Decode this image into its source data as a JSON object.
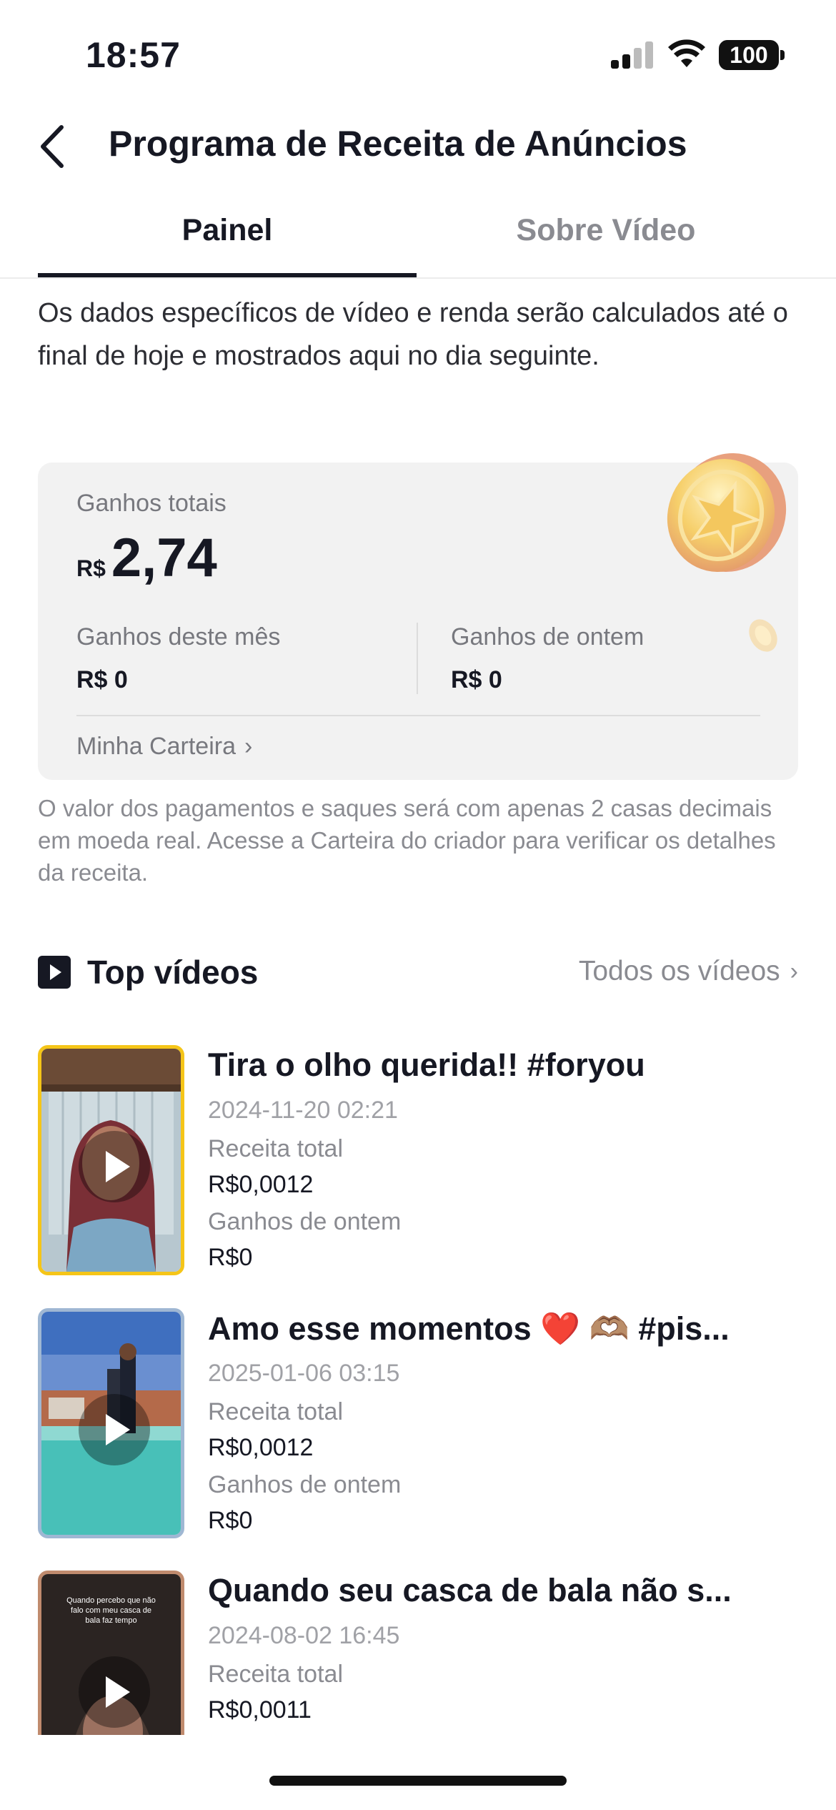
{
  "status_bar": {
    "time": "18:57",
    "battery": "100"
  },
  "header": {
    "title": "Programa de Receita de Anúncios"
  },
  "tabs": [
    {
      "label": "Painel",
      "active": true
    },
    {
      "label": "Sobre Vídeo",
      "active": false
    }
  ],
  "notice": "Os dados específicos de vídeo e renda serão calculados até o final de hoje e mostrados aqui no dia seguinte.",
  "earnings": {
    "total_label": "Ganhos totais",
    "currency": "R$",
    "total_amount": "2,74",
    "month_label": "Ganhos deste mês",
    "month_value": "R$ 0",
    "yesterday_label": "Ganhos de ontem",
    "yesterday_value": "R$ 0",
    "wallet_link": "Minha Carteira"
  },
  "payment_note": "O valor dos pagamentos e saques será com apenas 2 casas decimais em moeda real. Acesse a Carteira do criador para verificar os detalhes da receita.",
  "top_videos": {
    "title": "Top vídeos",
    "all_link": "Todos os vídeos",
    "items": [
      {
        "title": "Tira o olho querida!! #foryou",
        "date": "2024-11-20 02:21",
        "revenue_label": "Receita total",
        "revenue_value": "R$0,0012",
        "yesterday_label": "Ganhos de ontem",
        "yesterday_value": "R$0"
      },
      {
        "title": "Amo esse momentos ❤️ 🫶🏽 #pis...",
        "date": "2025-01-06 03:15",
        "revenue_label": "Receita total",
        "revenue_value": "R$0,0012",
        "yesterday_label": "Ganhos de ontem",
        "yesterday_value": "R$0"
      },
      {
        "title": "Quando seu casca de bala não s...",
        "date": "2024-08-02 16:45",
        "revenue_label": "Receita total",
        "revenue_value": "R$0,0011",
        "thumb_caption": "Quando percebo que não falo com meu casca de bala faz tempo"
      }
    ]
  },
  "colors": {
    "text_primary": "#161823",
    "text_secondary": "#8a8b91",
    "card_bg": "#f2f2f2",
    "thumb1_border": "#f5c518",
    "thumb2_border": "#9fb7d3",
    "thumb3_border": "#c08b6e"
  }
}
